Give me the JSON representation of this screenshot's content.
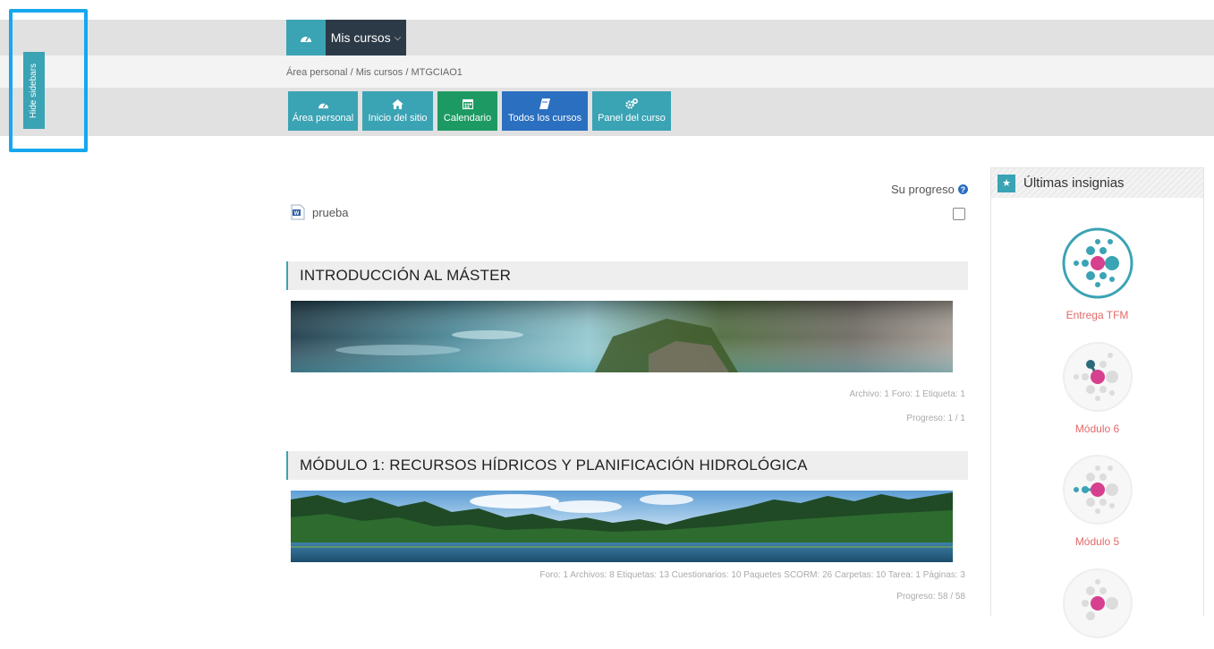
{
  "topnav": {
    "dashboard_icon": "dashboard-icon",
    "mis_cursos_label": "Mis cursos",
    "chevron_icon": "chevron-down-icon"
  },
  "breadcrumb": [
    "Área personal",
    "Mis cursos",
    "MTGCIAO1"
  ],
  "quicklinks": [
    {
      "label": "Área personal",
      "icon": "dashboard-icon",
      "color": "#3aa3b4"
    },
    {
      "label": "Inicio del sitio",
      "icon": "home-icon",
      "color": "#3aa3b4"
    },
    {
      "label": "Calendario",
      "icon": "calendar-icon",
      "color": "#1d9a63"
    },
    {
      "label": "Todos los cursos",
      "icon": "book-icon",
      "color": "#2a6fc0"
    },
    {
      "label": "Panel del curso",
      "icon": "gears-icon",
      "color": "#3aa3b4"
    }
  ],
  "sidebar_toggle": {
    "label": "Hide sidebars"
  },
  "progress": {
    "label": "Su progreso"
  },
  "file": {
    "name": "prueba",
    "icon": "word-document-icon"
  },
  "sections": [
    {
      "title": "INTRODUCCIÓN AL MÁSTER",
      "summary": "Archivo: 1  Foro: 1  Etiqueta: 1",
      "progress": "Progreso: 1 / 1"
    },
    {
      "title": "MÓDULO 1: RECURSOS HÍDRICOS Y PLANIFICACIÓN HIDROLÓGICA",
      "summary": "Foro: 1  Archivos: 8  Etiquetas: 13  Cuestionarios: 10  Paquetes SCORM: 26  Carpetas: 10  Tarea: 1  Páginas: 3",
      "progress": "Progreso: 58 / 58"
    }
  ],
  "badges_block": {
    "title": "Últimas insignias",
    "icon": "trophy-icon",
    "badges": [
      {
        "name": "Entrega TFM"
      },
      {
        "name": "Módulo 6"
      },
      {
        "name": "Módulo 5"
      },
      {
        "name": ""
      }
    ]
  },
  "colors": {
    "teal": "#3aa3b4",
    "green": "#1d9a63",
    "blue": "#2a6fc0",
    "dark": "#2c3a47",
    "badge_pink": "#d6408e",
    "badge_name": "#e26a6a",
    "highlight": "#16a7ef"
  }
}
